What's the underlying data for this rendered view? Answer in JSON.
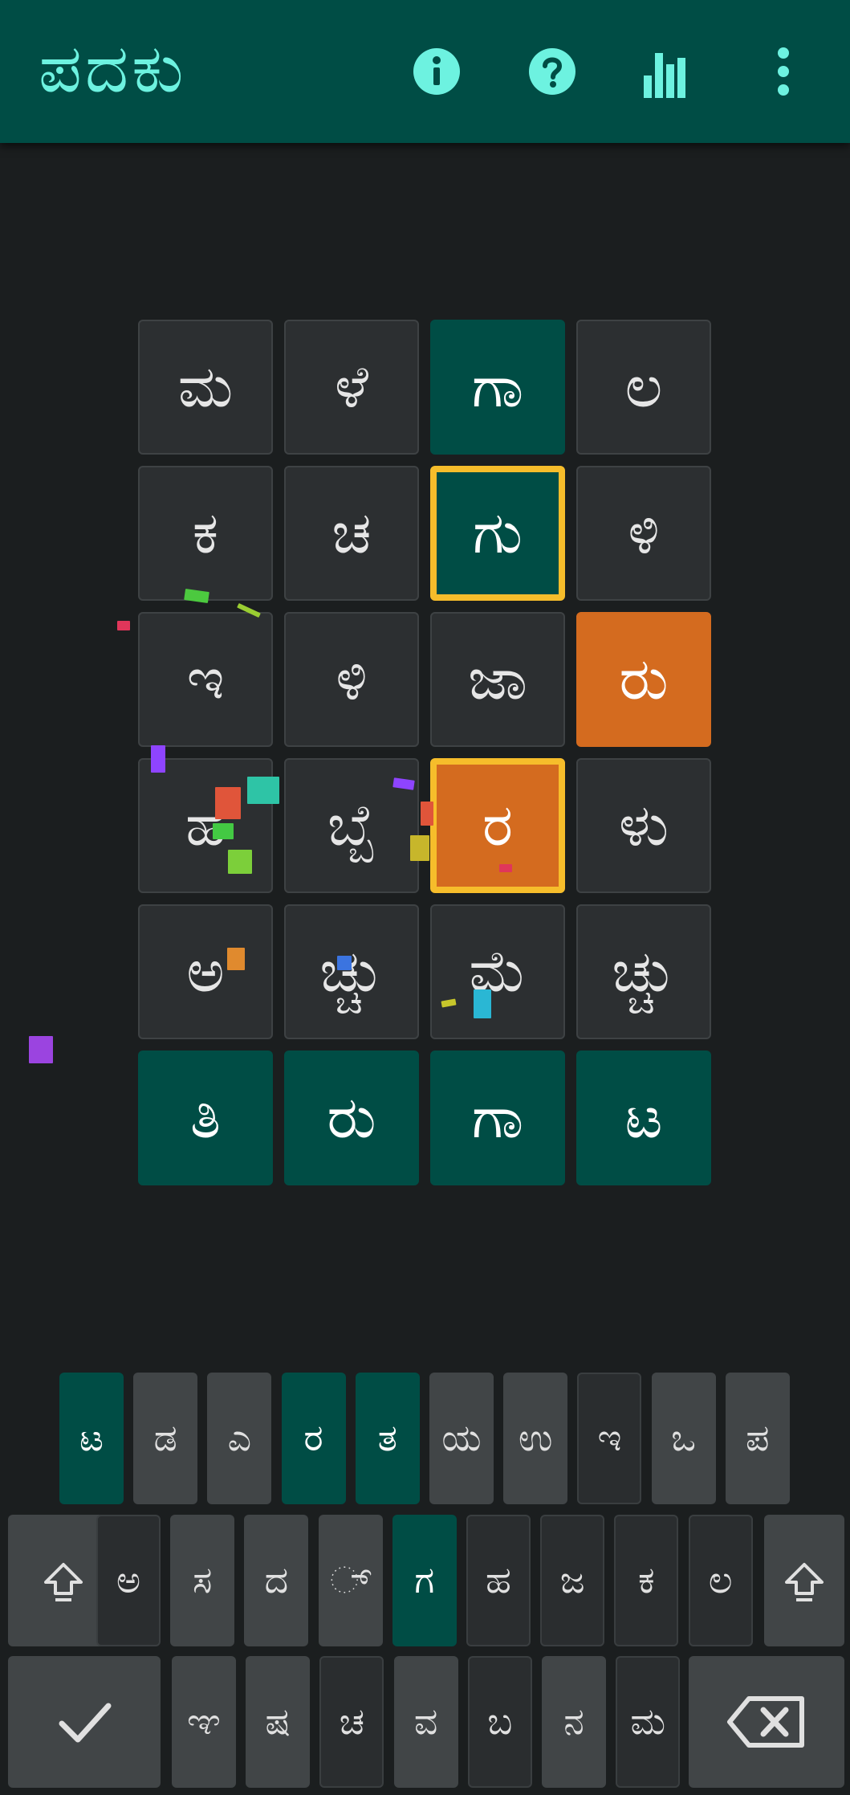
{
  "app": {
    "title": "ಪದಕು"
  },
  "toolbar": {
    "icons": [
      "info-icon",
      "help-icon",
      "stats-icon",
      "more-vert-icon"
    ],
    "accent": "#6df2e0",
    "bar_color": "#004d45"
  },
  "colors": {
    "correct": "#004d45",
    "present": "#d46b1f",
    "absent": "#2c2f31",
    "selected_border": "#f6bd2b",
    "background": "#1b1e1f"
  },
  "board": {
    "rows": [
      [
        {
          "ch": "ಮ",
          "state": "absent"
        },
        {
          "ch": "ಳೆ",
          "state": "absent"
        },
        {
          "ch": "ಗಾ",
          "state": "correct"
        },
        {
          "ch": "ಲ",
          "state": "absent"
        }
      ],
      [
        {
          "ch": "ಕ",
          "state": "absent"
        },
        {
          "ch": "ಚ",
          "state": "absent"
        },
        {
          "ch": "ಗು",
          "state": "correct",
          "selected": true
        },
        {
          "ch": "ಳಿ",
          "state": "absent"
        }
      ],
      [
        {
          "ch": "ಇ",
          "state": "absent"
        },
        {
          "ch": "ಳಿ",
          "state": "absent"
        },
        {
          "ch": "ಜಾ",
          "state": "absent"
        },
        {
          "ch": "ರು",
          "state": "present"
        }
      ],
      [
        {
          "ch": "ಹ",
          "state": "absent"
        },
        {
          "ch": "ಬ್ಬೆ",
          "state": "absent"
        },
        {
          "ch": "ರ",
          "state": "present",
          "selected": true
        },
        {
          "ch": "ಳು",
          "state": "absent"
        }
      ],
      [
        {
          "ch": "ಅ",
          "state": "absent"
        },
        {
          "ch": "ಚ್ಚು",
          "state": "absent"
        },
        {
          "ch": "ಮೆ",
          "state": "absent"
        },
        {
          "ch": "ಚ್ಚು",
          "state": "absent"
        }
      ],
      [
        {
          "ch": "ತಿ",
          "state": "correct"
        },
        {
          "ch": "ರು",
          "state": "correct"
        },
        {
          "ch": "ಗಾ",
          "state": "correct"
        },
        {
          "ch": "ಟ",
          "state": "correct"
        }
      ]
    ]
  },
  "keyboard": {
    "row1": [
      {
        "label": "ಟ",
        "state": "correct"
      },
      {
        "label": "ಡ",
        "state": "unused"
      },
      {
        "label": "ಎ",
        "state": "unused"
      },
      {
        "label": "ರ",
        "state": "correct"
      },
      {
        "label": "ತ",
        "state": "correct"
      },
      {
        "label": "ಯ",
        "state": "unused"
      },
      {
        "label": "ಉ",
        "state": "unused"
      },
      {
        "label": "ಇ",
        "state": "absent"
      },
      {
        "label": "ಒ",
        "state": "unused"
      },
      {
        "label": "ಪ",
        "state": "unused"
      }
    ],
    "row2": [
      {
        "label": "",
        "icon": "shift-icon",
        "state": "unused"
      },
      {
        "label": "ಅ",
        "state": "absent"
      },
      {
        "label": "ಸ",
        "state": "unused"
      },
      {
        "label": "ದ",
        "state": "unused"
      },
      {
        "label": "◌್",
        "state": "unused"
      },
      {
        "label": "ಗ",
        "state": "correct"
      },
      {
        "label": "ಹ",
        "state": "absent"
      },
      {
        "label": "ಜ",
        "state": "absent"
      },
      {
        "label": "ಕ",
        "state": "absent"
      },
      {
        "label": "ಲ",
        "state": "absent"
      },
      {
        "label": "",
        "icon": "shift-icon",
        "state": "unused"
      }
    ],
    "row3": [
      {
        "label": "",
        "icon": "check-icon",
        "state": "unused"
      },
      {
        "label": "ಞ",
        "state": "unused"
      },
      {
        "label": "ಷ",
        "state": "unused"
      },
      {
        "label": "ಚ",
        "state": "absent"
      },
      {
        "label": "ವ",
        "state": "unused"
      },
      {
        "label": "ಬ",
        "state": "absent"
      },
      {
        "label": "ನ",
        "state": "unused"
      },
      {
        "label": "ಮ",
        "state": "absent"
      },
      {
        "label": "",
        "icon": "backspace-icon",
        "state": "unused"
      }
    ]
  }
}
